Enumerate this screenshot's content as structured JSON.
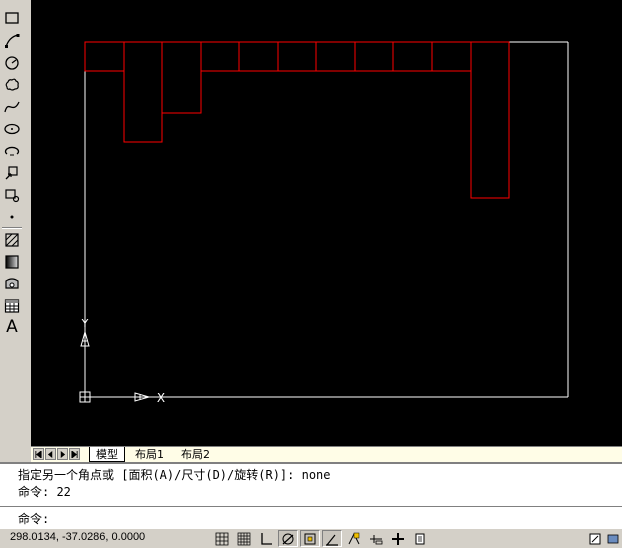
{
  "toolbar": {
    "tools": [
      {
        "name": "rectangle-icon"
      },
      {
        "name": "arc-icon"
      },
      {
        "name": "circle-icon"
      },
      {
        "name": "revision-cloud-icon"
      },
      {
        "name": "spline-icon"
      },
      {
        "name": "ellipse-icon"
      },
      {
        "name": "ellipse-arc-icon"
      },
      {
        "name": "insert-block-icon"
      },
      {
        "name": "make-block-icon"
      },
      {
        "name": "point-icon"
      },
      {
        "name": "hatch-icon"
      },
      {
        "name": "gradient-icon"
      },
      {
        "name": "region-icon"
      },
      {
        "name": "table-icon"
      },
      {
        "name": "multiline-text-icon",
        "glyph": "A"
      }
    ]
  },
  "canvas": {
    "background": "#000000",
    "line_colors": {
      "red": "#ff0000",
      "white": "#ffffff"
    },
    "ucs": {
      "y_label": "Y",
      "x_label": "X"
    }
  },
  "tabs": {
    "items": [
      "模型",
      "布局1",
      "布局2"
    ],
    "active": 0
  },
  "command": {
    "history": [
      "指定另一个角点或 [面积(A)/尺寸(D)/旋转(R)]: none",
      "命令: 22"
    ],
    "prompt": "命令:"
  },
  "status": {
    "coordinates": "298.0134, -37.0286, 0.0000",
    "buttons": [
      {
        "name": "snap-mode-button",
        "on": false
      },
      {
        "name": "grid-display-button",
        "on": false
      },
      {
        "name": "ortho-mode-button",
        "on": false
      },
      {
        "name": "polar-tracking-button",
        "on": true
      },
      {
        "name": "object-snap-button",
        "on": true
      },
      {
        "name": "object-snap-tracking-button",
        "on": true
      },
      {
        "name": "dynamic-ucs-button",
        "on": false
      },
      {
        "name": "dynamic-input-button",
        "on": false
      },
      {
        "name": "lineweight-button",
        "on": false
      },
      {
        "name": "quick-properties-button",
        "on": false
      }
    ]
  }
}
